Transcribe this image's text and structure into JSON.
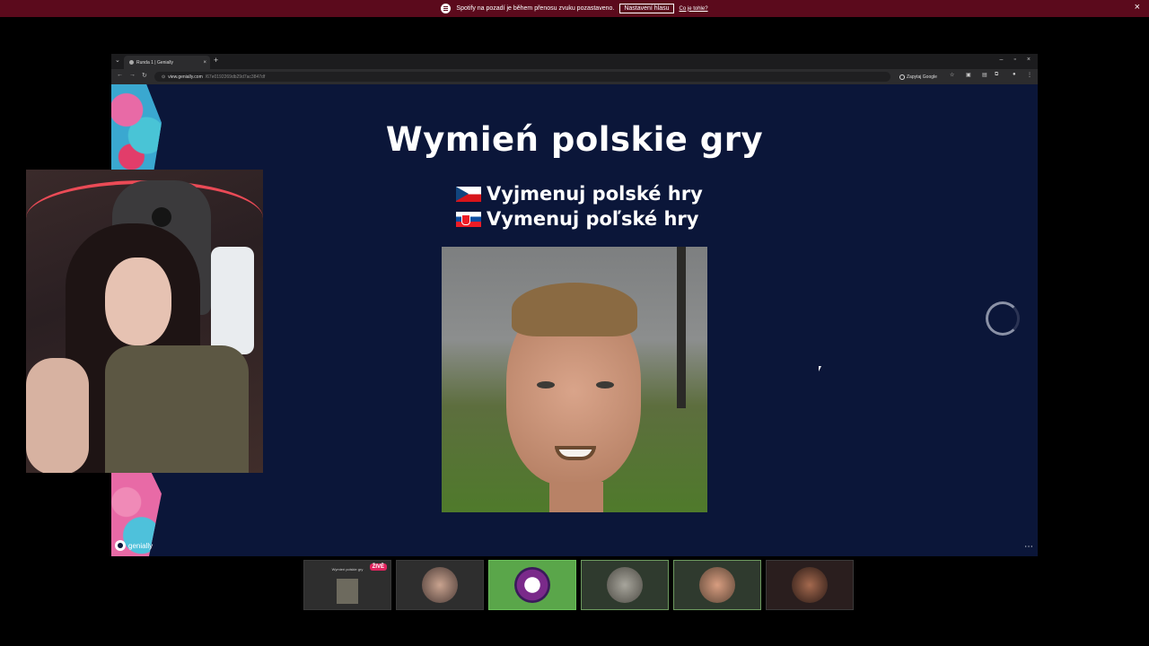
{
  "notification": {
    "message": "Spotify na pozadí je během přenosu zvuku pozastaveno.",
    "button": "Nastavení hlasu",
    "link": "Co je tohle?"
  },
  "browser": {
    "tab_title": "Runda 1 | Genially",
    "url_domain": "view.genially.com",
    "url_path": "/67e0192269db29d7ac3847df",
    "search_button": "Zapytaj Google"
  },
  "slide": {
    "title": "Wymień polskie gry",
    "subtitles": [
      {
        "flag": "czech-flag-icon",
        "text": "Vyjmenuj polské hry"
      },
      {
        "flag": "slovak-flag-icon",
        "text": "Vymenuj poľské hry"
      }
    ],
    "brand": "genially"
  },
  "participants": {
    "live_badge": "ŽIVĚ",
    "slide_thumb_title": "Wymień polskie gry",
    "tiles": [
      "slide-preview",
      "participant-2",
      "participant-3",
      "participant-4",
      "participant-5",
      "participant-6"
    ]
  }
}
